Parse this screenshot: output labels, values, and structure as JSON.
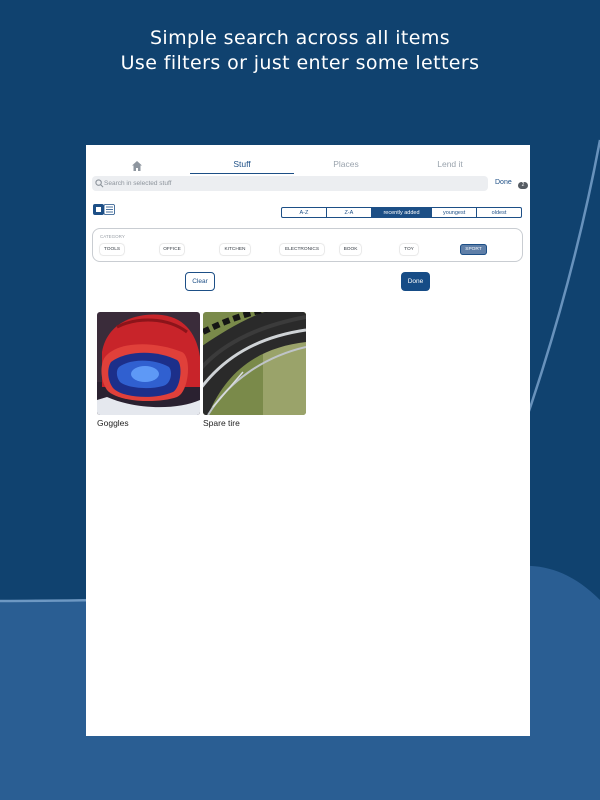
{
  "headline": {
    "line1": "Simple search across all items",
    "line2": "Use filters or just enter some letters"
  },
  "colors": {
    "primary": "#1d4f86",
    "background_top": "#10426f",
    "background_bottom": "#2a5e93"
  },
  "tabs": [
    {
      "label": "",
      "icon": "home-icon"
    },
    {
      "label": "Stuff",
      "active": true
    },
    {
      "label": "Places"
    },
    {
      "label": "Lend it"
    }
  ],
  "search": {
    "placeholder": "Search in selected stuff",
    "done_label": "Done",
    "badge": "2"
  },
  "sort_options": [
    "A-Z",
    "Z-A",
    "recently added",
    "youngest",
    "oldest"
  ],
  "sort_active": "recently added",
  "category": {
    "title": "CATEGORY",
    "chips": [
      "TOOLS",
      "OFFICE",
      "KITCHEN",
      "ELECTRONICS",
      "BOOK",
      "TOY",
      "SPORT"
    ],
    "active": "SPORT"
  },
  "buttons": {
    "clear": "Clear",
    "done": "Done"
  },
  "items": [
    {
      "name": "Goggles",
      "image": "red-helmet-goggles-photo"
    },
    {
      "name": "Spare tire",
      "image": "bike-tire-photo"
    }
  ]
}
